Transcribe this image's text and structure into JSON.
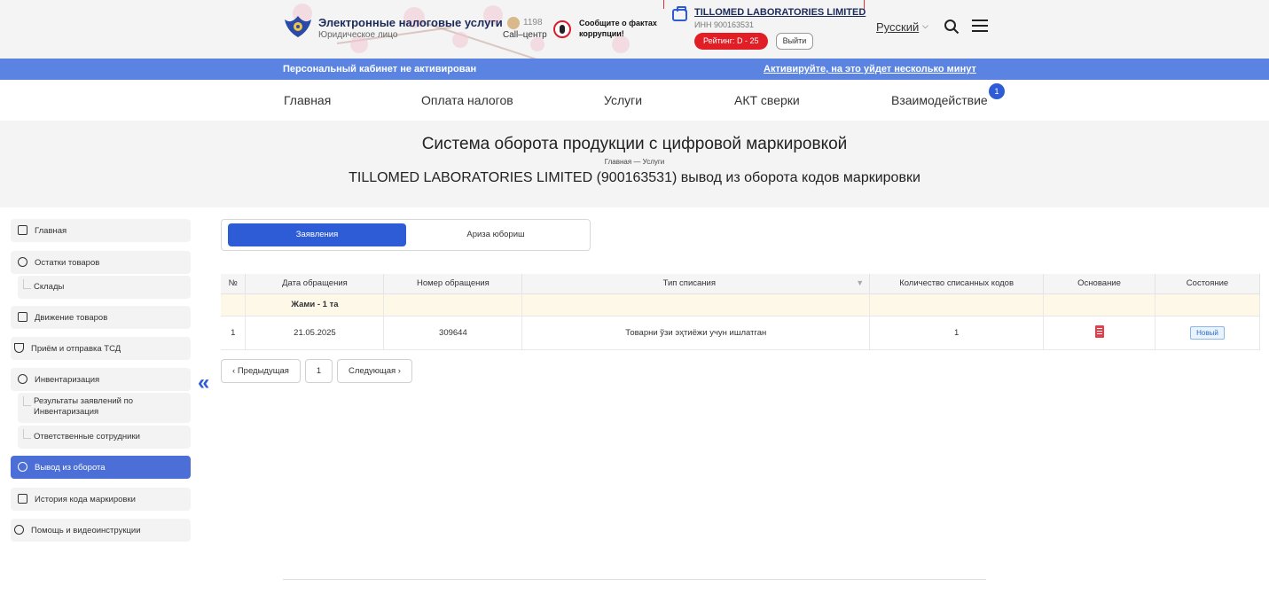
{
  "header": {
    "brand_title": "Электронные налоговые услуги",
    "brand_subtitle": "Юридическое лицо",
    "call_number": "1198",
    "call_label": "Call–центр",
    "corruption_text": "Сообщите о фактах коррупции!",
    "company_name": "TILLOMED LABORATORIES LIMITED",
    "inn": "ИНН 900163531",
    "rating": "Рейтинг: D - 25",
    "logout_label": "Выйти",
    "language": "Русский"
  },
  "banner": {
    "left_text": "Персональный кабинет не активирован",
    "right_link": "Активируйте, на это уйдет несколько минут"
  },
  "nav": {
    "items": [
      "Главная",
      "Оплата налогов",
      "Услуги",
      "АКТ сверки",
      "Взаимодействие"
    ],
    "badge": "1"
  },
  "page": {
    "title": "Система оборота продукции с цифровой маркировкой",
    "breadcrumb": "Главная  —  Услуги",
    "subtitle": "TILLOMED LABORATORIES LIMITED (900163531) вывод из оборота кодов маркировки"
  },
  "sidebar": {
    "items": [
      {
        "label": "Главная"
      },
      {
        "label": "Остатки товаров"
      },
      {
        "label": "Склады"
      },
      {
        "label": "Движение товаров"
      },
      {
        "label": "Приём и отправка ТСД"
      },
      {
        "label": "Инвентаризация"
      },
      {
        "label": "Результаты заявлений по Инвентаризация"
      },
      {
        "label": "Ответственные сотрудники"
      },
      {
        "label": "Вывод из оборота"
      },
      {
        "label": "История кода маркировки"
      },
      {
        "label": "Помощь и видеоинструкции"
      }
    ]
  },
  "tabs": [
    "Заявления",
    "Ариза юбориш"
  ],
  "table": {
    "columns": [
      "№",
      "Дата обращения",
      "Номер обращения",
      "Тип списания",
      "Количество списанных кодов",
      "Основание",
      "Состояние"
    ],
    "group_label": "Жами - 1 та",
    "rows": [
      {
        "num": "1",
        "date": "21.05.2025",
        "number": "309644",
        "type": "Товарни ўзи эҳтиёжи учун ишлатган",
        "count": "1",
        "status": "Новый"
      }
    ]
  },
  "pagination": {
    "prev": "‹  Предыдущая",
    "page": "1",
    "next": "Следующая  ›"
  },
  "colors": {
    "accent": "#2e5cd6",
    "banner": "#5b84e2",
    "rating_red": "#e11d25",
    "group_row": "#fdf8e8"
  }
}
